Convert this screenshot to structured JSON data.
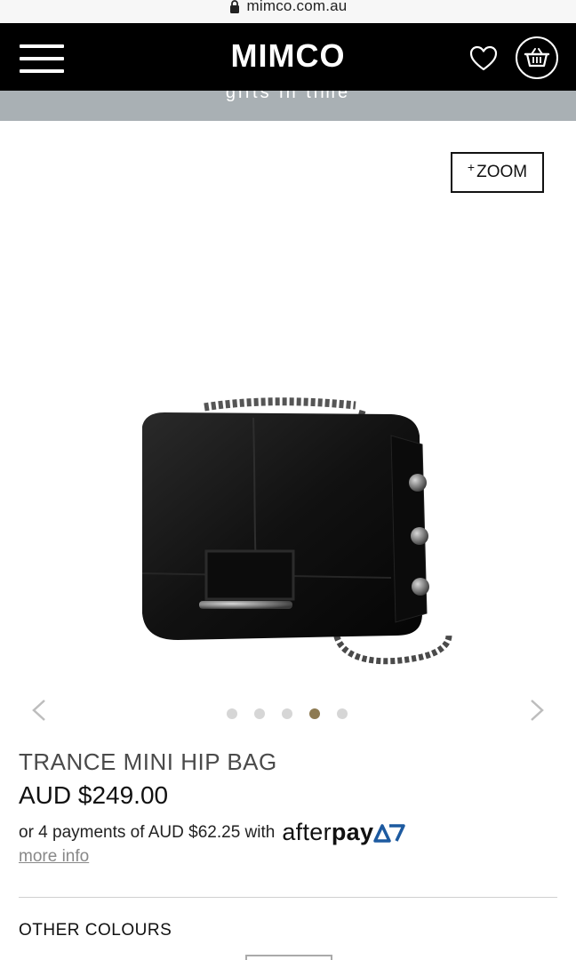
{
  "browser": {
    "url": "mimco.com.au"
  },
  "header": {
    "logo": "MIMCO",
    "tagline": "gifts in time"
  },
  "gallery": {
    "zoom_plus": "+",
    "zoom_label": "ZOOM",
    "dot_count": 5,
    "active_dot": 4,
    "accent_color": "#8d7a52"
  },
  "product": {
    "title": "TRANCE MINI HIP BAG",
    "price": "AUD $249.00",
    "installment_text": "or 4 payments of AUD $62.25 with",
    "afterpay_after": "after",
    "afterpay_pay": "pay",
    "more_info": "more info"
  },
  "other_colours": {
    "heading": "OTHER COLOURS"
  },
  "icons": [
    "lock-icon",
    "menu-icon",
    "heart-icon",
    "basket-icon",
    "chevron-left-icon",
    "chevron-right-icon",
    "afterpay-icon"
  ]
}
